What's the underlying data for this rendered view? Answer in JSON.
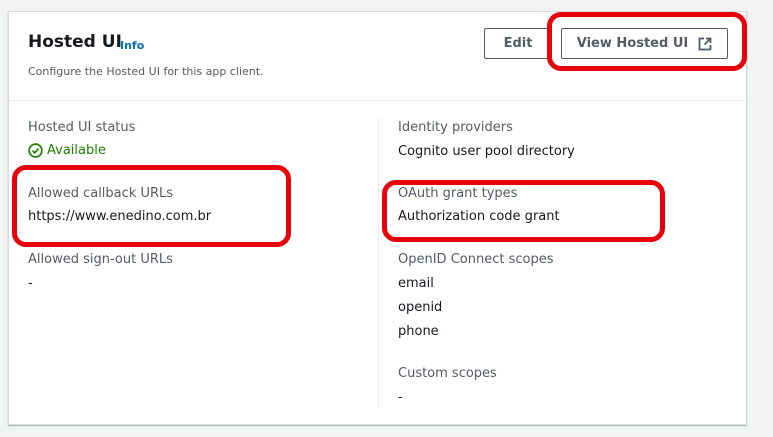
{
  "header": {
    "title": "Hosted UI",
    "info_label": "Info",
    "description": "Configure the Hosted UI for this app client.",
    "edit_label": "Edit",
    "view_label": "View Hosted UI",
    "view_icon": "external-link-icon"
  },
  "left_column": {
    "status": {
      "label": "Hosted UI status",
      "value": "Available",
      "icon": "status-check-icon"
    },
    "callback": {
      "label": "Allowed callback URLs",
      "value": "https://www.enedino.com.br"
    },
    "signout": {
      "label": "Allowed sign-out URLs",
      "value": "-"
    }
  },
  "right_column": {
    "identity": {
      "label": "Identity providers",
      "value": "Cognito user pool directory"
    },
    "grant": {
      "label": "OAuth grant types",
      "value": "Authorization code grant"
    },
    "oidc": {
      "label": "OpenID Connect scopes",
      "values": [
        "email",
        "openid",
        "phone"
      ]
    },
    "custom": {
      "label": "Custom scopes",
      "value": "-"
    }
  },
  "colors": {
    "accent_link": "#0073bb",
    "status_green": "#1d8102",
    "highlight_red": "#e8000b"
  }
}
